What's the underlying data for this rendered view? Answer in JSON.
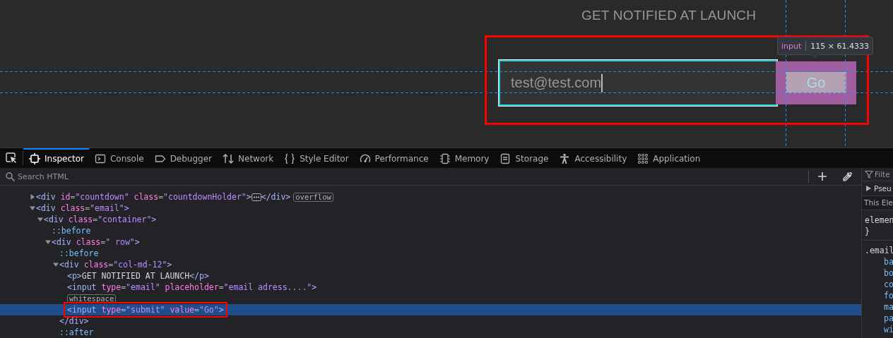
{
  "page": {
    "heading": "GET NOTIFIED AT LAUNCH",
    "email_field": {
      "value": "test@test.com"
    },
    "submit_button": {
      "label": "Go"
    },
    "tooltip": {
      "tag": "input",
      "size": "115 × 61.4333"
    }
  },
  "toolbar": {
    "tabs": [
      {
        "label": "Inspector",
        "selected": true
      },
      {
        "label": "Console",
        "selected": false
      },
      {
        "label": "Debugger",
        "selected": false
      },
      {
        "label": "Network",
        "selected": false
      },
      {
        "label": "Style Editor",
        "selected": false
      },
      {
        "label": "Performance",
        "selected": false
      },
      {
        "label": "Memory",
        "selected": false
      },
      {
        "label": "Storage",
        "selected": false
      },
      {
        "label": "Accessibility",
        "selected": false
      },
      {
        "label": "Application",
        "selected": false
      }
    ]
  },
  "markup": {
    "search": {
      "placeholder": "Search HTML"
    },
    "nodes": [
      {
        "segments": [
          {
            "text": "<div",
            "kind": "tag"
          },
          {
            "text": " id",
            "kind": "attr"
          },
          {
            "text": "=",
            "kind": "punct"
          },
          {
            "text": "\"countdown\"",
            "kind": "value"
          },
          {
            "text": " class",
            "kind": "attr"
          },
          {
            "text": "=",
            "kind": "punct"
          },
          {
            "text": "\"countdownHolder\"",
            "kind": "value"
          },
          {
            "text": ">",
            "kind": "tag"
          }
        ],
        "expanded": false,
        "closing": "</div>",
        "badges": [
          "overflow"
        ],
        "selected": false
      },
      {
        "segments": [
          {
            "text": "<div",
            "kind": "tag"
          },
          {
            "text": " class",
            "kind": "attr"
          },
          {
            "text": "=",
            "kind": "punct"
          },
          {
            "text": "\"email\"",
            "kind": "value"
          },
          {
            "text": ">",
            "kind": "tag"
          }
        ],
        "expanded": true,
        "selected": false,
        "children": [
          {
            "segments": [
              {
                "text": "<div",
                "kind": "tag"
              },
              {
                "text": " class",
                "kind": "attr"
              },
              {
                "text": "=",
                "kind": "punct"
              },
              {
                "text": "\"container\"",
                "kind": "value"
              },
              {
                "text": ">",
                "kind": "tag"
              }
            ],
            "expanded": true,
            "selected": false,
            "children": [
              {
                "segments": [
                  {
                    "text": "::before",
                    "kind": "pseudo"
                  }
                ],
                "selected": false
              },
              {
                "segments": [
                  {
                    "text": "<div",
                    "kind": "tag"
                  },
                  {
                    "text": " class",
                    "kind": "attr"
                  },
                  {
                    "text": "=",
                    "kind": "punct"
                  },
                  {
                    "text": "\" row\"",
                    "kind": "value"
                  },
                  {
                    "text": ">",
                    "kind": "tag"
                  }
                ],
                "expanded": true,
                "selected": false,
                "children": [
                  {
                    "segments": [
                      {
                        "text": "::before",
                        "kind": "pseudo"
                      }
                    ],
                    "selected": false
                  },
                  {
                    "segments": [
                      {
                        "text": "<div",
                        "kind": "tag"
                      },
                      {
                        "text": " class",
                        "kind": "attr"
                      },
                      {
                        "text": "=",
                        "kind": "punct"
                      },
                      {
                        "text": "\"col-md-12\"",
                        "kind": "value"
                      },
                      {
                        "text": ">",
                        "kind": "tag"
                      }
                    ],
                    "expanded": true,
                    "selected": false,
                    "closing": "</div>",
                    "children": [
                      {
                        "segments": [
                          {
                            "text": "<p>",
                            "kind": "tag"
                          },
                          {
                            "text": "GET NOTIFIED AT LAUNCH",
                            "kind": "text"
                          },
                          {
                            "text": "</p>",
                            "kind": "tag"
                          }
                        ],
                        "selected": false
                      },
                      {
                        "segments": [
                          {
                            "text": "<input",
                            "kind": "tag"
                          },
                          {
                            "text": " type",
                            "kind": "attr"
                          },
                          {
                            "text": "=",
                            "kind": "punct"
                          },
                          {
                            "text": "\"email\"",
                            "kind": "value"
                          },
                          {
                            "text": " placeholder",
                            "kind": "attr"
                          },
                          {
                            "text": "=",
                            "kind": "punct"
                          },
                          {
                            "text": "\"email adress....\"",
                            "kind": "value"
                          },
                          {
                            "text": ">",
                            "kind": "tag"
                          }
                        ],
                        "selected": false
                      },
                      {
                        "badges": [
                          "whitespace"
                        ],
                        "selected": false
                      },
                      {
                        "segments": [
                          {
                            "text": "<input",
                            "kind": "tag"
                          },
                          {
                            "text": " type",
                            "kind": "attr"
                          },
                          {
                            "text": "=",
                            "kind": "punct"
                          },
                          {
                            "text": "\"submit\"",
                            "kind": "value"
                          },
                          {
                            "text": " value",
                            "kind": "attr"
                          },
                          {
                            "text": "=",
                            "kind": "punct"
                          },
                          {
                            "text": "\"Go\"",
                            "kind": "value"
                          },
                          {
                            "text": ">",
                            "kind": "tag"
                          }
                        ],
                        "selected": true
                      }
                    ]
                  },
                  {
                    "segments": [
                      {
                        "text": "::after",
                        "kind": "pseudo"
                      }
                    ],
                    "selected": false
                  }
                ]
              }
            ]
          }
        ]
      }
    ]
  },
  "rules": {
    "filter": {
      "placeholder": "Filte"
    },
    "pseudo_toggle": {
      "label": "Pseu",
      "expanded": false
    },
    "this_element": "This Ele",
    "element_rule": {
      "selector": "elemen",
      "brace": "}"
    },
    "email_rule": {
      "selector": ".email",
      "properties": [
        "ba",
        "bo",
        "co",
        "fo",
        "ma",
        "pa",
        "wi"
      ]
    }
  }
}
